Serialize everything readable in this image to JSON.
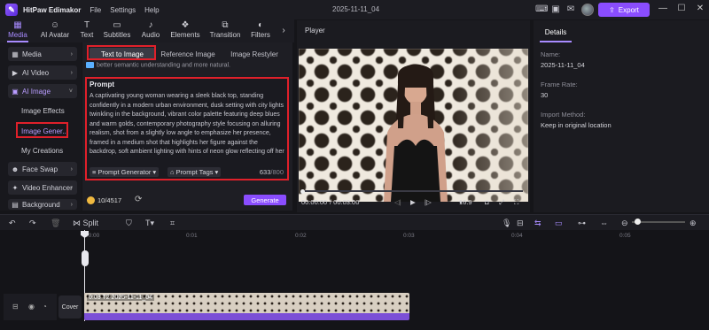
{
  "app": {
    "name": "HitPaw Edimakor",
    "menu": [
      "File",
      "Settings",
      "Help"
    ],
    "doc_title": "2025-11-11_04",
    "export_label": "Export",
    "brand_color": "#8a4dff"
  },
  "toolbar": {
    "tabs": [
      {
        "label": "Media",
        "icon": "media-icon"
      },
      {
        "label": "AI Avatar",
        "icon": "ai-avatar-icon"
      },
      {
        "label": "Text",
        "icon": "text-icon"
      },
      {
        "label": "Subtitles",
        "icon": "subtitles-icon"
      },
      {
        "label": "Audio",
        "icon": "audio-icon"
      },
      {
        "label": "Elements",
        "icon": "elements-icon"
      },
      {
        "label": "Transition",
        "icon": "transition-icon"
      },
      {
        "label": "Filters",
        "icon": "filters-icon"
      }
    ],
    "active": "Media"
  },
  "sidebar": {
    "items": [
      {
        "label": "Media"
      },
      {
        "label": "AI Video"
      },
      {
        "label": "AI Image"
      },
      {
        "label": "Face Swap"
      },
      {
        "label": "Video Enhancer"
      },
      {
        "label": "Background"
      }
    ],
    "subitems": [
      "Image Effects",
      "Image Gener...",
      "My Creations"
    ]
  },
  "generator": {
    "tabs": [
      "Text to Image",
      "Reference Image",
      "Image Restyler"
    ],
    "notice": "better semantic understanding and more natural.",
    "prompt_title": "Prompt",
    "prompt_text": "A captivating young woman wearing a sleek black top, standing confidently in a modern urban environment, dusk setting with city lights twinkling in the background, vibrant color palette featuring deep blues and warm golds, contemporary photography style focusing on alluring realism, shot from a slightly low angle to emphasize her presence, framed in a medium shot that highlights her figure against the backdrop, soft ambient lighting with hints of neon glow reflecting off her",
    "prompt_generator": "Prompt Generator",
    "prompt_tags": "Prompt Tags",
    "char_count": "633",
    "char_max": "/800",
    "credits": "10/4517",
    "generate_label": "Generate"
  },
  "player": {
    "title": "Player",
    "time_current": "00:00:00",
    "time_total": "/ 00:03:00",
    "aspect": "16:9"
  },
  "details": {
    "tab": "Details",
    "name_label": "Name:",
    "name_value": "2025-11-11_04",
    "frame_rate_label": "Frame Rate:",
    "frame_rate_value": "30",
    "import_label": "Import Method:",
    "import_value": "Keep in original location"
  },
  "timeline": {
    "split_label": "Split",
    "ruler": [
      "00:00",
      "0:01",
      "0:02",
      "0:03",
      "0:04",
      "0:05"
    ],
    "cover_label": "Cover",
    "clip_label": "0:03  T2  2025-11-11_04"
  }
}
